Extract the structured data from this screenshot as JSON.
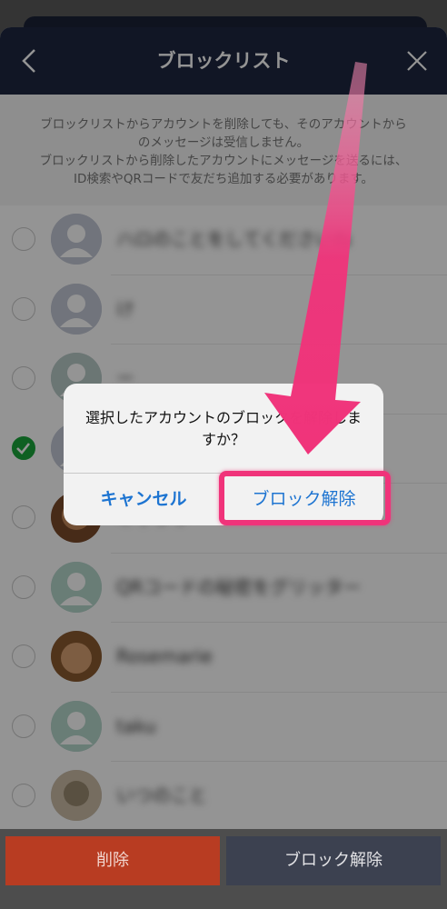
{
  "header": {
    "title": "ブロックリスト"
  },
  "notice": {
    "line1": "ブロックリストからアカウントを削除しても、そのアカウントから",
    "line2": "のメッセージは受信しません。",
    "line3": "ブロックリストから削除したアカウントにメッセージを送るには、",
    "line4": "ID検索やQRコードで友だち追加する必要があります。"
  },
  "list": {
    "items": [
      {
        "name": "ハロのことをしてくださいね",
        "checked": false
      },
      {
        "name": "け",
        "checked": false
      },
      {
        "name": "ー",
        "checked": false
      },
      {
        "name": "",
        "checked": true
      },
      {
        "name": "ギャラリー",
        "checked": false
      },
      {
        "name": "QRコードの秘密をグリッター",
        "checked": false
      },
      {
        "name": "Rosemarie",
        "checked": false
      },
      {
        "name": "taku",
        "checked": false
      },
      {
        "name": "いつのこと",
        "checked": false
      }
    ]
  },
  "dialog": {
    "message": "選択したアカウントのブロックを解除しますか？",
    "cancel_label": "キャンセル",
    "confirm_label": "ブロック解除"
  },
  "footer": {
    "delete_label": "削除",
    "unblock_label": "ブロック解除"
  },
  "colors": {
    "header_bg": "#1e2740",
    "delete_bg": "#d6432a",
    "unblock_bg": "#555b70",
    "dialog_button": "#1d74d1",
    "highlight": "#f0337a",
    "check_green": "#1aa53c"
  }
}
